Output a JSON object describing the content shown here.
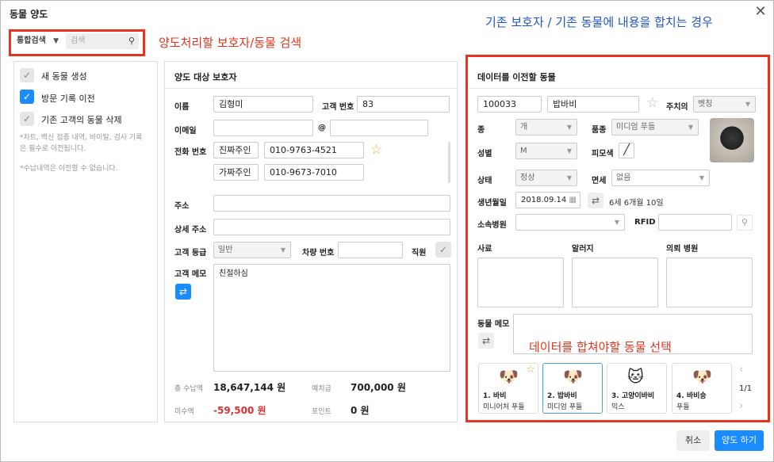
{
  "dialog": {
    "title": "동물 양도"
  },
  "annotations": {
    "header": "기존 보호자 / 기존 동물에 내용을 합치는 경우",
    "search": "양도처리할 보호자/동물 검색",
    "merge_select": "데이터를 합쳐야할 동물 선택"
  },
  "search": {
    "type_label": "통합검색",
    "placeholder": "검색"
  },
  "options": {
    "items": [
      {
        "label": "새 동물 생성",
        "checked": false
      },
      {
        "label": "방문 기록 이전",
        "checked": true
      },
      {
        "label": "기존 고객의 동물 삭제",
        "checked": false
      }
    ],
    "note1": "*차트, 백신 접종 내역, 바이탈, 검사 기록은 필수로 이전됩니다.",
    "note2": "*수납내역은 이전할 수 없습니다."
  },
  "owner": {
    "header": "양도 대상 보호자",
    "name_label": "이름",
    "name_value": "김형미",
    "id_label": "고객 번호",
    "id_value": "83",
    "email_label": "이메일",
    "at": "@",
    "phone_label": "전화 번호",
    "phone1_name": "진짜주인",
    "phone1": "010-9763-4521",
    "phone2_name": "가짜주인",
    "phone2": "010-9673-7010",
    "address_label": "주소",
    "address_detail_label": "상세 주소",
    "grade_label": "고객 등급",
    "grade_value": "일반",
    "car_label": "차량 번호",
    "staff_label": "직원",
    "memo_label": "고객 메모",
    "memo_value": "친절하심",
    "total_paid_label": "총 수납액",
    "total_paid": "18,647,144 원",
    "deposit_label": "예치금",
    "deposit": "700,000 원",
    "unpaid_label": "미수액",
    "unpaid": "-59,500 원",
    "point_label": "포인트",
    "point": "0 원"
  },
  "animal": {
    "header": "데이터를 이전할 동물",
    "id": "100033",
    "name": "밥바비",
    "vet_label": "주치의",
    "vet_value": "벳칭",
    "species_label": "종",
    "species": "개",
    "breed_label": "품종",
    "breed": "미디엄 푸들",
    "sex_label": "성별",
    "sex": "M",
    "coat_label": "피모색",
    "status_label": "상태",
    "status": "정상",
    "neuter_label": "면세",
    "neuter": "없음",
    "birth_label": "생년월일",
    "birth": "2018.09.14",
    "age": "6세 6개월 10일",
    "hospital_label": "소속병원",
    "rfid_label": "RFID",
    "food_label": "사료",
    "allergy_label": "알러지",
    "referral_label": "의뢰 병원",
    "memo_label": "동물 메모",
    "cards": [
      {
        "name": "1. 바비",
        "breed": "미니어처 푸들",
        "icon": "dog-icon"
      },
      {
        "name": "2. 밥바비",
        "breed": "미디엄 푸들",
        "icon": "dog-icon"
      },
      {
        "name": "3. 고양이바비",
        "breed": "믹스",
        "icon": "cat-icon"
      },
      {
        "name": "4. 바비숑",
        "breed": "푸들",
        "icon": "dog-icon"
      }
    ],
    "page": "1/1"
  },
  "footer": {
    "cancel": "취소",
    "confirm": "양도 하기"
  },
  "colors": {
    "accent": "#1a8cff",
    "annotation_red": "#e8341c",
    "annotation_blue": "#2255cc",
    "negative": "#e03030"
  }
}
